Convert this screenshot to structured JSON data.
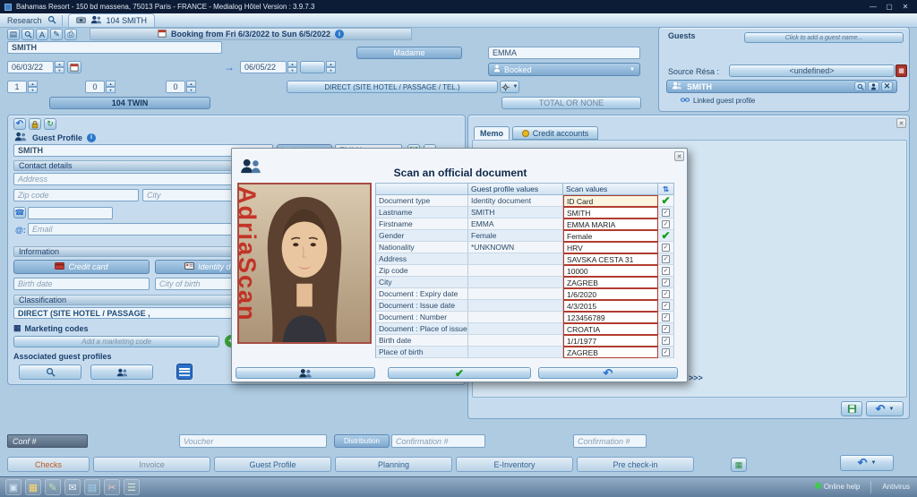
{
  "titlebar": {
    "title": "Bahamas Resort  -  150 bd massena, 75013 Paris  -  FRANCE  -  Medialog Hôtel Version : 3.9.7.3",
    "minimize": "—",
    "maximize": "▢",
    "close": "✕"
  },
  "menubar": {
    "research_label": "Research",
    "room_tab_label": "104 SMITH"
  },
  "booking": {
    "header": "Booking from Fri 6/3/2022 to Sun 6/5/2022",
    "lastname": "SMITH",
    "arrival_date": "06/03/22",
    "departure_date": "06/05/22",
    "adults": "1",
    "children": "0",
    "babies": "0",
    "rate_code": "DIRECT (SITE HOTEL / PASSAGE / TEL.)",
    "room_label": "104 TWIN",
    "total_label": "TOTAL OR NONE",
    "civility": "Madame",
    "firstname": "EMMA",
    "status": "Booked"
  },
  "guests": {
    "title": "Guests",
    "add_guest_label": "Click to add a guest name...",
    "source_resa_label": "Source Résa :",
    "source_resa_value": "<undefined>",
    "guest_row_name": "SMITH",
    "linked_profile_label": "Linked guest profile"
  },
  "guest_profile": {
    "title": "Guest Profile",
    "lastname": "SMITH",
    "civility": "Madame",
    "firstname": "EMMA",
    "contact_section": "Contact details",
    "address_placeholder": "Address",
    "zip_placeholder": "Zip code",
    "city_placeholder": "City",
    "email_at": "@:",
    "email_placeholder": "Email",
    "information_section": "Information",
    "credit_card_button": "Credit card",
    "identity_doc_button": "Identity document",
    "birth_date_placeholder": "Birth date",
    "city_of_birth_placeholder": "City of birth",
    "classification_section": "Classification",
    "classification_value": "DIRECT (SITE HOTEL / PASSAGE ,",
    "marketing_section": "Marketing codes",
    "add_marketing_placeholder": "Add a marketing code",
    "associated_section": "Associated guest profiles"
  },
  "memo_panel": {
    "tab_memo": "Memo",
    "tab_credit": "Credit accounts",
    "pager": ">>>"
  },
  "scan_dialog": {
    "title": "Scan an official document",
    "watermark": "AdriaScan",
    "col_profile": "Guest profile values",
    "col_scan": "Scan values",
    "rows": [
      {
        "field": "Document type",
        "profile": "Identity document",
        "scan": "ID Card",
        "check": "confirm"
      },
      {
        "field": "Lastname",
        "profile": "SMITH",
        "scan": "SMITH",
        "check": "checkbox"
      },
      {
        "field": "Firstname",
        "profile": "EMMA",
        "scan": "EMMA MARIA",
        "check": "checkbox"
      },
      {
        "field": "Gender",
        "profile": "Female",
        "scan": "Female",
        "check": "confirm"
      },
      {
        "field": "Nationality",
        "profile": "*UNKNOWN",
        "scan": "HRV",
        "check": "checkbox"
      },
      {
        "field": "Address",
        "profile": "",
        "scan": "SAVSKA CESTA 31",
        "check": "checkbox"
      },
      {
        "field": "Zip code",
        "profile": "",
        "scan": "10000",
        "check": "checkbox"
      },
      {
        "field": "City",
        "profile": "",
        "scan": "ZAGREB",
        "check": "checkbox"
      },
      {
        "field": "Document : Expiry date",
        "profile": "",
        "scan": "1/6/2020",
        "check": "checkbox"
      },
      {
        "field": "Document : Issue date",
        "profile": "",
        "scan": "4/3/2015",
        "check": "checkbox"
      },
      {
        "field": "Document : Number",
        "profile": "",
        "scan": "123456789",
        "check": "checkbox"
      },
      {
        "field": "Document : Place of issue",
        "profile": "",
        "scan": "CROATIA",
        "check": "checkbox"
      },
      {
        "field": "Birth date",
        "profile": "",
        "scan": "1/1/1977",
        "check": "checkbox"
      },
      {
        "field": "Place of birth",
        "profile": "",
        "scan": "ZAGREB",
        "check": "checkbox"
      }
    ]
  },
  "footer": {
    "conf_label": "Conf #",
    "voucher_placeholder": "Voucher",
    "distribution_label": "Distribution",
    "confirmation_placeholder": "Confirmation #",
    "confirmation2_placeholder": "Confirmation #",
    "nav_tabs": [
      "Checks",
      "Invoice",
      "Guest Profile",
      "Planning",
      "E-Inventory",
      "Pre check-in"
    ],
    "online_help": "Online help",
    "antivirus": "Antivirus"
  },
  "taskbar": {
    "icons": [
      {
        "name": "window-icon",
        "glyph": "▣",
        "color": "#cfe3f2"
      },
      {
        "name": "calendar-icon",
        "glyph": "▦",
        "color": "#ffd76e"
      },
      {
        "name": "notes-icon",
        "glyph": "✎",
        "color": "#bfe3a8"
      },
      {
        "name": "mail-icon",
        "glyph": "✉",
        "color": "#e8f0f8"
      },
      {
        "name": "stats-icon",
        "glyph": "▤",
        "color": "#9fd0f0"
      },
      {
        "name": "cut-icon",
        "glyph": "✂",
        "color": "#f0c4c4"
      },
      {
        "name": "menu-icon",
        "glyph": "☰",
        "color": "#d8e4d0"
      }
    ]
  },
  "colors": {
    "accent": "#2a76c9",
    "scan_border": "#b23b2e",
    "ok_green": "#189c18"
  }
}
